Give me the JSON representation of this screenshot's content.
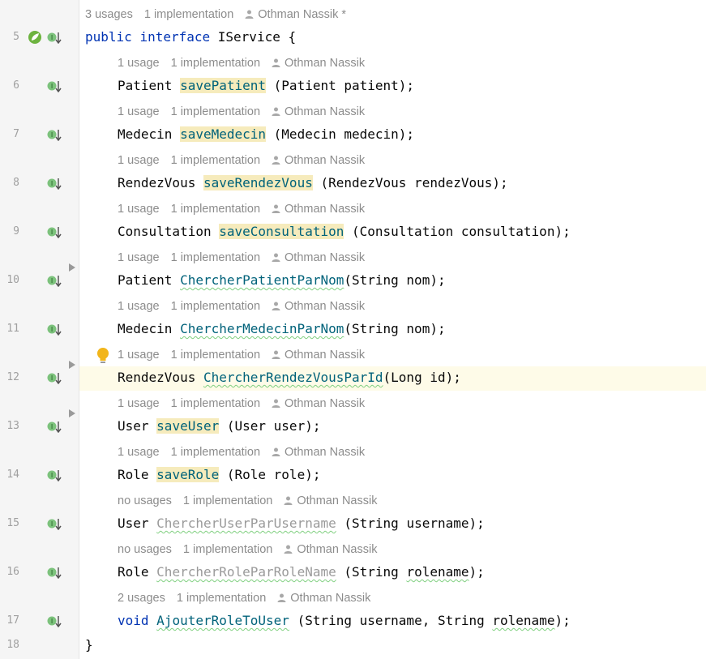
{
  "hints": {
    "interface": {
      "usages": "3 usages",
      "impl": "1 implementation",
      "author": "Othman Nassik *"
    },
    "m1": {
      "usages": "1 usage",
      "impl": "1 implementation",
      "author": "Othman Nassik"
    },
    "m2": {
      "usages": "1 usage",
      "impl": "1 implementation",
      "author": "Othman Nassik"
    },
    "m3": {
      "usages": "1 usage",
      "impl": "1 implementation",
      "author": "Othman Nassik"
    },
    "m4": {
      "usages": "1 usage",
      "impl": "1 implementation",
      "author": "Othman Nassik"
    },
    "m5": {
      "usages": "1 usage",
      "impl": "1 implementation",
      "author": "Othman Nassik"
    },
    "m6": {
      "usages": "1 usage",
      "impl": "1 implementation",
      "author": "Othman Nassik"
    },
    "m7": {
      "usages": "1 usage",
      "impl": "1 implementation",
      "author": "Othman Nassik"
    },
    "m8": {
      "usages": "1 usage",
      "impl": "1 implementation",
      "author": "Othman Nassik"
    },
    "m9": {
      "usages": "1 usage",
      "impl": "1 implementation",
      "author": "Othman Nassik"
    },
    "m10": {
      "usages": "no usages",
      "impl": "1 implementation",
      "author": "Othman Nassik"
    },
    "m11": {
      "usages": "no usages",
      "impl": "1 implementation",
      "author": "Othman Nassik"
    },
    "m12": {
      "usages": "2 usages",
      "impl": "1 implementation",
      "author": "Othman Nassik"
    }
  },
  "lines": {
    "l5": "5",
    "l6": "6",
    "l7": "7",
    "l8": "8",
    "l9": "9",
    "l10": "10",
    "l11": "11",
    "l12": "12",
    "l13": "13",
    "l14": "14",
    "l15": "15",
    "l16": "16",
    "l17": "17",
    "l18": "18"
  },
  "code": {
    "kw_public": "public",
    "kw_interface": "interface",
    "iface_name": " IService {",
    "close": "}",
    "c1": {
      "ret": "Patient ",
      "name": "savePatient",
      "params": " (Patient patient);"
    },
    "c2": {
      "ret": "Medecin ",
      "name": "saveMedecin",
      "params": " (Medecin medecin);"
    },
    "c3": {
      "ret": "RendezVous ",
      "name": "saveRendezVous",
      "params": " (RendezVous rendezVous);"
    },
    "c4": {
      "ret": "Consultation ",
      "name": "saveConsultation",
      "params": " (Consultation consultation);"
    },
    "c5": {
      "ret": "Patient ",
      "name": "ChercherPatientParNom",
      "params": "(String nom);"
    },
    "c6": {
      "ret": "Medecin ",
      "name": "ChercherMedecinParNom",
      "params": "(String nom);"
    },
    "c7": {
      "ret": "RendezVous ",
      "name": "ChercherRendezVousParId",
      "params": "(Long id);"
    },
    "c8": {
      "ret": "User ",
      "name": "saveUser",
      "params": " (User user);"
    },
    "c9": {
      "ret": "Role ",
      "name": "saveRole",
      "params": " (Role role);"
    },
    "c10": {
      "ret": "User ",
      "name": "ChercherUserParUsername",
      "params_a": " (String ",
      "params_b": "username",
      "params_c": ");"
    },
    "c11": {
      "ret": "Role ",
      "name": "ChercherRoleParRoleName",
      "params_a": " (String ",
      "params_b": "rolename",
      "params_c": ");"
    },
    "c12": {
      "ret": "void",
      "name": "AjouterRoleToUser",
      "params_a": " (String username, String ",
      "params_b": "rolename",
      "params_c": ");"
    }
  },
  "icons": {
    "implemented": "implemented-method-icon",
    "spring": "spring-bean-icon",
    "fold": "fold-arrow-icon",
    "bulb": "lightbulb-icon",
    "author": "person-icon"
  },
  "colors": {
    "keyword": "#0033b3",
    "method": "#00627a",
    "highlight": "#f6ebbc",
    "hint": "#8c8c8c",
    "unused": "#9a9a9a",
    "current_line": "#fefbe8"
  }
}
